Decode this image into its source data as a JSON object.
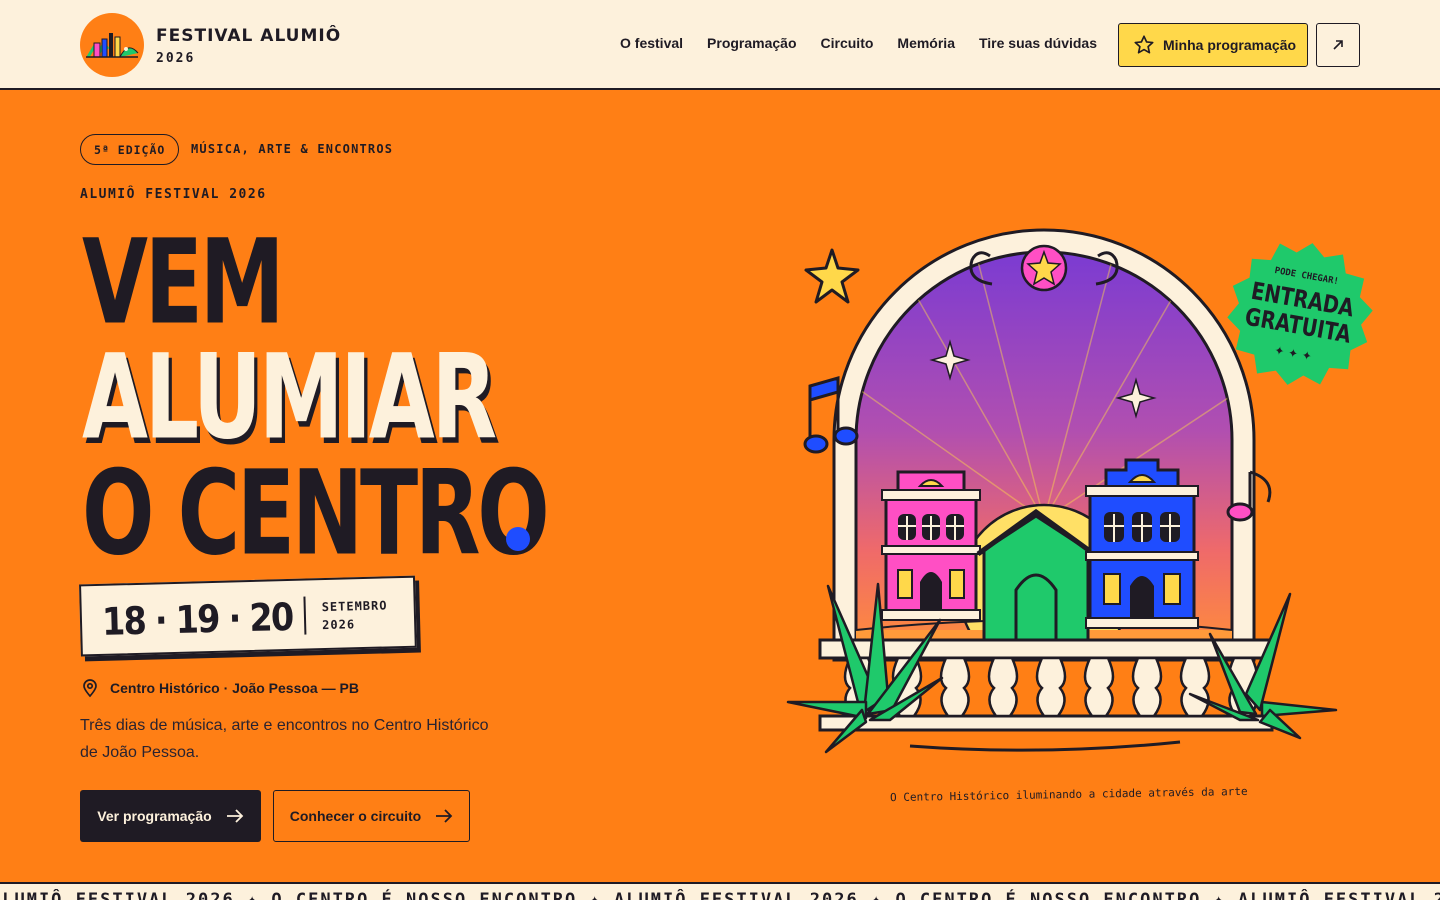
{
  "header": {
    "brand_name": "FESTIVAL ALUMIÔ",
    "brand_year": "2026",
    "nav": [
      "O festival",
      "Programação",
      "Circuito",
      "Memória",
      "Tire suas dúvidas"
    ],
    "cta_label": "Minha programação",
    "external_icon": "arrow-up-right-icon",
    "cta_icon": "star-icon"
  },
  "hero": {
    "edition_badge": "5ª EDIÇÃO",
    "tagline": "MÚSICA, ARTE & ENCONTROS",
    "kicker": "ALUMIÔ FESTIVAL 2026",
    "headline": [
      "VEM",
      "ALUMIAR",
      "O CENTRO"
    ],
    "dates": "18 · 19 · 20",
    "month": "SETEMBRO",
    "year": "2026",
    "location": "Centro Histórico · João Pessoa — PB",
    "description": "Três dias de música, arte e encontros no Centro Histórico de João Pessoa.",
    "primary_button": "Ver programação",
    "secondary_button": "Conhecer o circuito",
    "sticker_top": "PODE CHEGAR!",
    "sticker_line1": "ENTRADA",
    "sticker_line2": "GRATUITA",
    "sticker_bottom": "✦ ✦ ✦",
    "caption": "O Centro Histórico iluminando a cidade através da arte"
  },
  "ticker": {
    "items": [
      "ALUMIÔ FESTIVAL 2026",
      "O CENTRO É NOSSO ENCONTRO"
    ]
  },
  "colors": {
    "orange": "#ff7f15",
    "cream": "#fdf1dc",
    "ink": "#1f1b24",
    "yellow": "#ffd84a",
    "blue": "#1f4dff",
    "green": "#1fc96b",
    "pink": "#ff4fc4",
    "purple": "#8a3cc9"
  }
}
